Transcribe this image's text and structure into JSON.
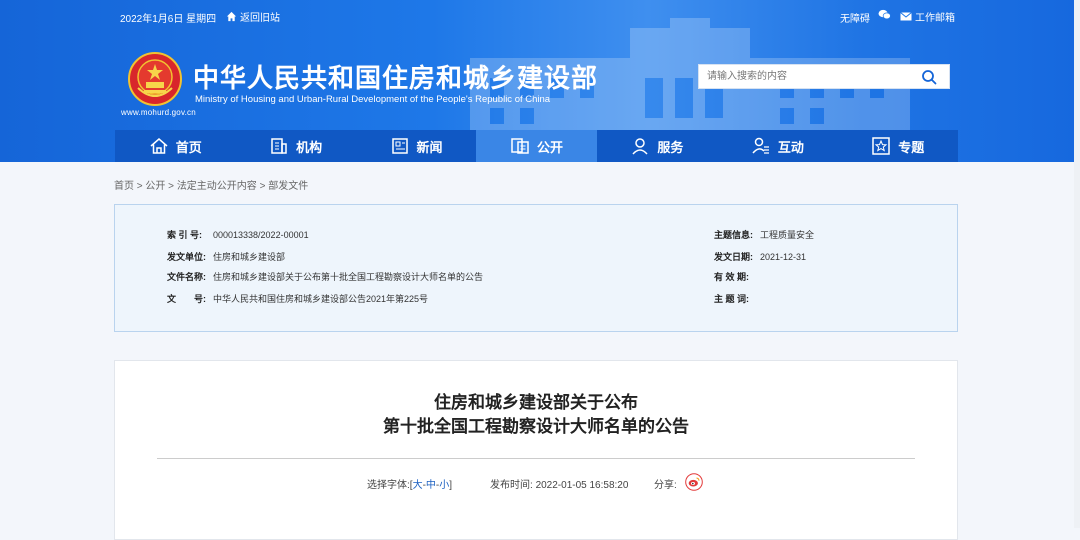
{
  "topbar": {
    "date": "2022年1月6日 星期四",
    "back_old": "返回旧站",
    "accessibility": "无障碍",
    "mail": "工作邮箱"
  },
  "header": {
    "title_cn": "中华人民共和国住房和城乡建设部",
    "title_en": "Ministry of Housing and Urban-Rural Development of the People's Republic of China",
    "site_url": "www.mohurd.gov.cn",
    "search_placeholder": "请输入搜索的内容"
  },
  "nav": [
    {
      "label": "首页",
      "icon": "home-icon"
    },
    {
      "label": "机构",
      "icon": "building-icon"
    },
    {
      "label": "新闻",
      "icon": "newspaper-icon"
    },
    {
      "label": "公开",
      "icon": "documents-icon",
      "active": true
    },
    {
      "label": "服务",
      "icon": "service-person-icon"
    },
    {
      "label": "互动",
      "icon": "interaction-icon"
    },
    {
      "label": "专题",
      "icon": "star-icon"
    }
  ],
  "breadcrumb": {
    "home": "首页",
    "sep": " > ",
    "gongkai": "公开",
    "fading": "法定主动公开内容",
    "bufa": "部发文件"
  },
  "meta": {
    "index_label": "索 引 号:",
    "index_value": "000013338/2022-00001",
    "unit_label": "发文单位:",
    "unit_value": "住房和城乡建设部",
    "name_label": "文件名称:",
    "name_value": "住房和城乡建设部关于公布第十批全国工程勘察设计大师名单的公告",
    "docno_label": "文　　号:",
    "docno_value": "中华人民共和国住房和城乡建设部公告2021年第225号",
    "topic_label": "主题信息:",
    "topic_value": "工程质量安全",
    "date_label": "发文日期:",
    "date_value": "2021-12-31",
    "valid_label": "有 效 期:",
    "valid_value": "",
    "keywords_label": "主 题 词:",
    "keywords_value": ""
  },
  "article": {
    "title_line1": "住房和城乡建设部关于公布",
    "title_line2": "第十批全国工程勘察设计大师名单的公告",
    "font_label": "选择字体:",
    "bracket_open": "[",
    "font_large": "大",
    "font_medium": "中",
    "font_small": "小",
    "dash": "-",
    "bracket_close": "]",
    "publish_label": "发布时间:",
    "publish_time": "2022-01-05 16:58:20",
    "share_label": "分享:"
  },
  "colors": {
    "header_blue": "#1e78e8",
    "nav_blue": "#1058c4",
    "nav_active": "#3a86e6",
    "meta_bg": "#eef5fc",
    "link_blue": "#1a5fc0"
  }
}
